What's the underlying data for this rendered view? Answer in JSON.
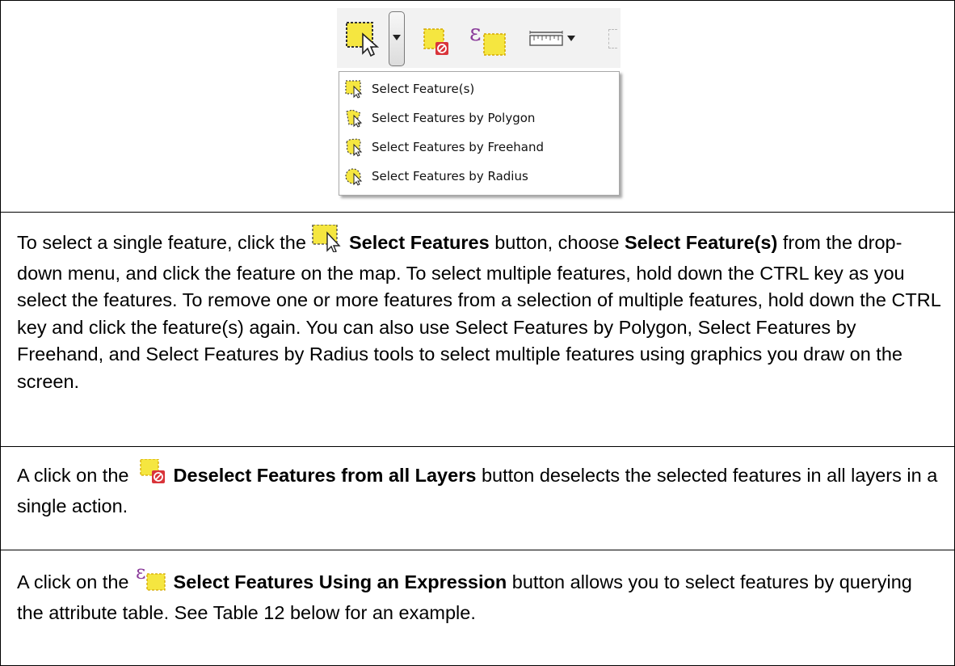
{
  "menu": {
    "items": [
      {
        "label": "Select Feature(s)",
        "icon": "select-feature-icon"
      },
      {
        "label": "Select Features by Polygon",
        "icon": "select-polygon-icon"
      },
      {
        "label": "Select Features by Freehand",
        "icon": "select-freehand-icon"
      },
      {
        "label": "Select Features by Radius",
        "icon": "select-radius-icon"
      }
    ]
  },
  "rows": {
    "select": {
      "t1": "To select a single feature, click the ",
      "b1": "Select Features",
      "t2": " button, choose ",
      "b2": "Select Feature(s)",
      "t3": " from the drop-down menu, and click the feature on the map. To select multiple features, hold down the CTRL key as you select the features. To remove one or more features from a selection of multiple features, hold down the CTRL key and click the feature(s) again.  You can also use Select Features by Polygon, Select Features by Freehand, and Select Features by Radius tools to select multiple features using graphics you draw on the screen."
    },
    "deselect": {
      "t1": "A click on the ",
      "b1": "Deselect Features from all Layers",
      "t2": " button deselects the selected features in all layers in a single action."
    },
    "expression": {
      "t1": "A click on the ",
      "b1": "Select Features Using an Expression",
      "t2": " button allows you to select features by querying the attribute table. See Table 12 below for an example."
    }
  },
  "colors": {
    "feature_yellow": "#f5e640",
    "deselect_red": "#d9343a",
    "expression_purple": "#8a3b9a"
  }
}
